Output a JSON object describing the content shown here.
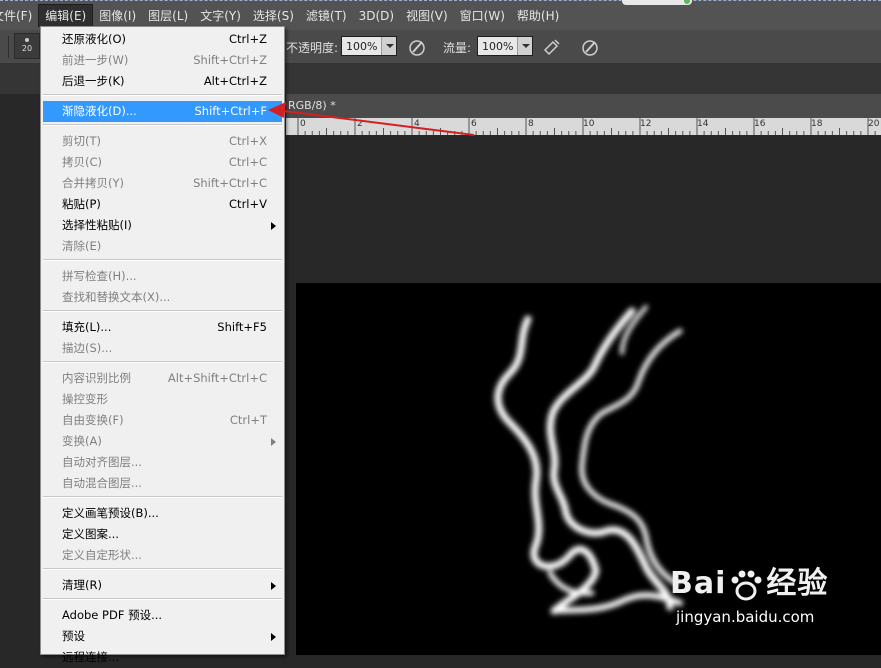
{
  "menubar": {
    "items": [
      {
        "label": "文件(F)"
      },
      {
        "label": "编辑(E)"
      },
      {
        "label": "图像(I)"
      },
      {
        "label": "图层(L)"
      },
      {
        "label": "文字(Y)"
      },
      {
        "label": "选择(S)"
      },
      {
        "label": "滤镜(T)"
      },
      {
        "label": "3D(D)"
      },
      {
        "label": "视图(V)"
      },
      {
        "label": "窗口(W)"
      },
      {
        "label": "帮助(H)"
      }
    ],
    "active_index": 1
  },
  "options": {
    "brush_size": "20",
    "opacity_label": "不透明度:",
    "opacity_value": "100%",
    "flow_label": "流量:",
    "flow_value": "100%"
  },
  "document": {
    "tab_text": "RGB/8) *",
    "ruler_labels": [
      "0",
      "2",
      "4",
      "6",
      "8",
      "10",
      "12",
      "14",
      "16",
      "18",
      "20"
    ]
  },
  "edit_menu": {
    "items": [
      {
        "label": "还原液化(O)",
        "shortcut": "Ctrl+Z",
        "enabled": true
      },
      {
        "label": "前进一步(W)",
        "shortcut": "Shift+Ctrl+Z",
        "enabled": false
      },
      {
        "label": "后退一步(K)",
        "shortcut": "Alt+Ctrl+Z",
        "enabled": true
      },
      {
        "label": "渐隐液化(D)...",
        "shortcut": "Shift+Ctrl+F",
        "enabled": true,
        "highlighted": true
      },
      {
        "label": "剪切(T)",
        "shortcut": "Ctrl+X",
        "enabled": false
      },
      {
        "label": "拷贝(C)",
        "shortcut": "Ctrl+C",
        "enabled": false
      },
      {
        "label": "合并拷贝(Y)",
        "shortcut": "Shift+Ctrl+C",
        "enabled": false
      },
      {
        "label": "粘贴(P)",
        "shortcut": "Ctrl+V",
        "enabled": true
      },
      {
        "label": "选择性粘贴(I)",
        "shortcut": "",
        "enabled": true,
        "submenu": true
      },
      {
        "label": "清除(E)",
        "shortcut": "",
        "enabled": false
      },
      {
        "label": "拼写检查(H)...",
        "shortcut": "",
        "enabled": false
      },
      {
        "label": "查找和替换文本(X)...",
        "shortcut": "",
        "enabled": false
      },
      {
        "label": "填充(L)...",
        "shortcut": "Shift+F5",
        "enabled": true
      },
      {
        "label": "描边(S)...",
        "shortcut": "",
        "enabled": false
      },
      {
        "label": "内容识别比例",
        "shortcut": "Alt+Shift+Ctrl+C",
        "enabled": false
      },
      {
        "label": "操控变形",
        "shortcut": "",
        "enabled": false
      },
      {
        "label": "自由变换(F)",
        "shortcut": "Ctrl+T",
        "enabled": false
      },
      {
        "label": "变换(A)",
        "shortcut": "",
        "enabled": false,
        "submenu": true
      },
      {
        "label": "自动对齐图层...",
        "shortcut": "",
        "enabled": false
      },
      {
        "label": "自动混合图层...",
        "shortcut": "",
        "enabled": false
      },
      {
        "label": "定义画笔预设(B)...",
        "shortcut": "",
        "enabled": true
      },
      {
        "label": "定义图案...",
        "shortcut": "",
        "enabled": true
      },
      {
        "label": "定义自定形状...",
        "shortcut": "",
        "enabled": false
      },
      {
        "label": "清理(R)",
        "shortcut": "",
        "enabled": true,
        "submenu": true
      },
      {
        "label": "Adobe PDF 预设...",
        "shortcut": "",
        "enabled": true
      },
      {
        "label": "预设",
        "shortcut": "",
        "enabled": true,
        "submenu": true
      },
      {
        "label": "远程连接...",
        "shortcut": "",
        "enabled": true
      }
    ]
  },
  "watermark": {
    "logo_text": "Bai",
    "logo_suffix": "经验",
    "url": "jingyan.baidu.com"
  },
  "colors": {
    "highlight": "#3399ff",
    "annotation_arrow": "#d42020"
  }
}
